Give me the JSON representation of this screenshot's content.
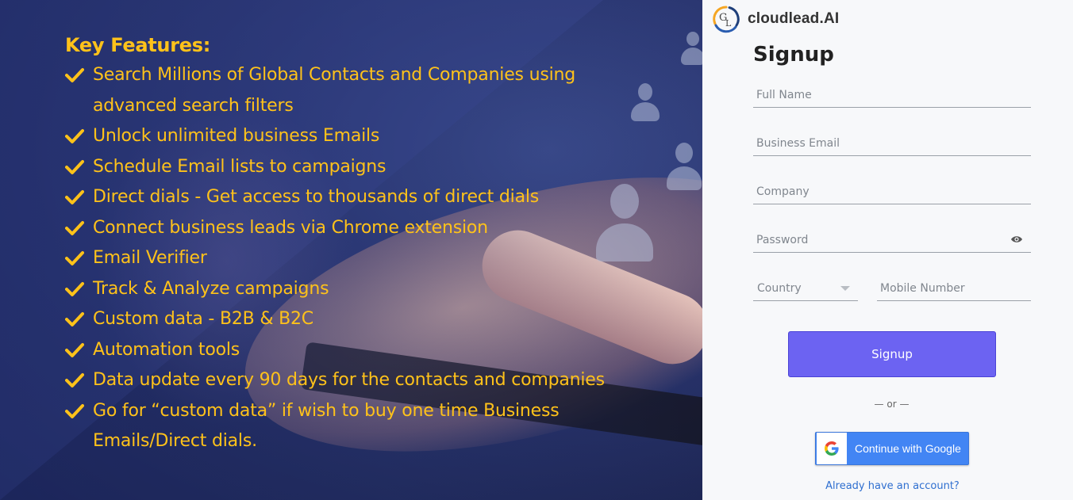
{
  "hero": {
    "heading": "Key Features:",
    "features": [
      "Search Millions of Global Contacts and Companies using advanced search filters",
      "Unlock unlimited business Emails",
      "Schedule Email lists to campaigns",
      "Direct dials - Get access to thousands of direct dials",
      "Connect business leads via Chrome extension",
      "Email Verifier",
      "Track & Analyze campaigns",
      "Custom data - B2B & B2C",
      "Automation tools",
      "Data update every 90 days for the contacts and companies",
      "Go for “custom data” if wish to buy one time Business Emails/Direct dials."
    ],
    "accent_color": "#ffc21a"
  },
  "brand": {
    "logo_icon": "cloudlead-logo-icon",
    "name": "cloudlead.AI"
  },
  "form": {
    "title": "Signup",
    "full_name_placeholder": "Full Name",
    "email_placeholder": "Business Email",
    "company_placeholder": "Company",
    "password_placeholder": "Password",
    "country_label": "Country",
    "mobile_placeholder": "Mobile Number",
    "submit_label": "Signup",
    "divider": "— or —",
    "google_label": "Continue with Google",
    "login_link": "Already have an account?",
    "button_color": "#6c63f2",
    "google_color": "#4285f4"
  }
}
